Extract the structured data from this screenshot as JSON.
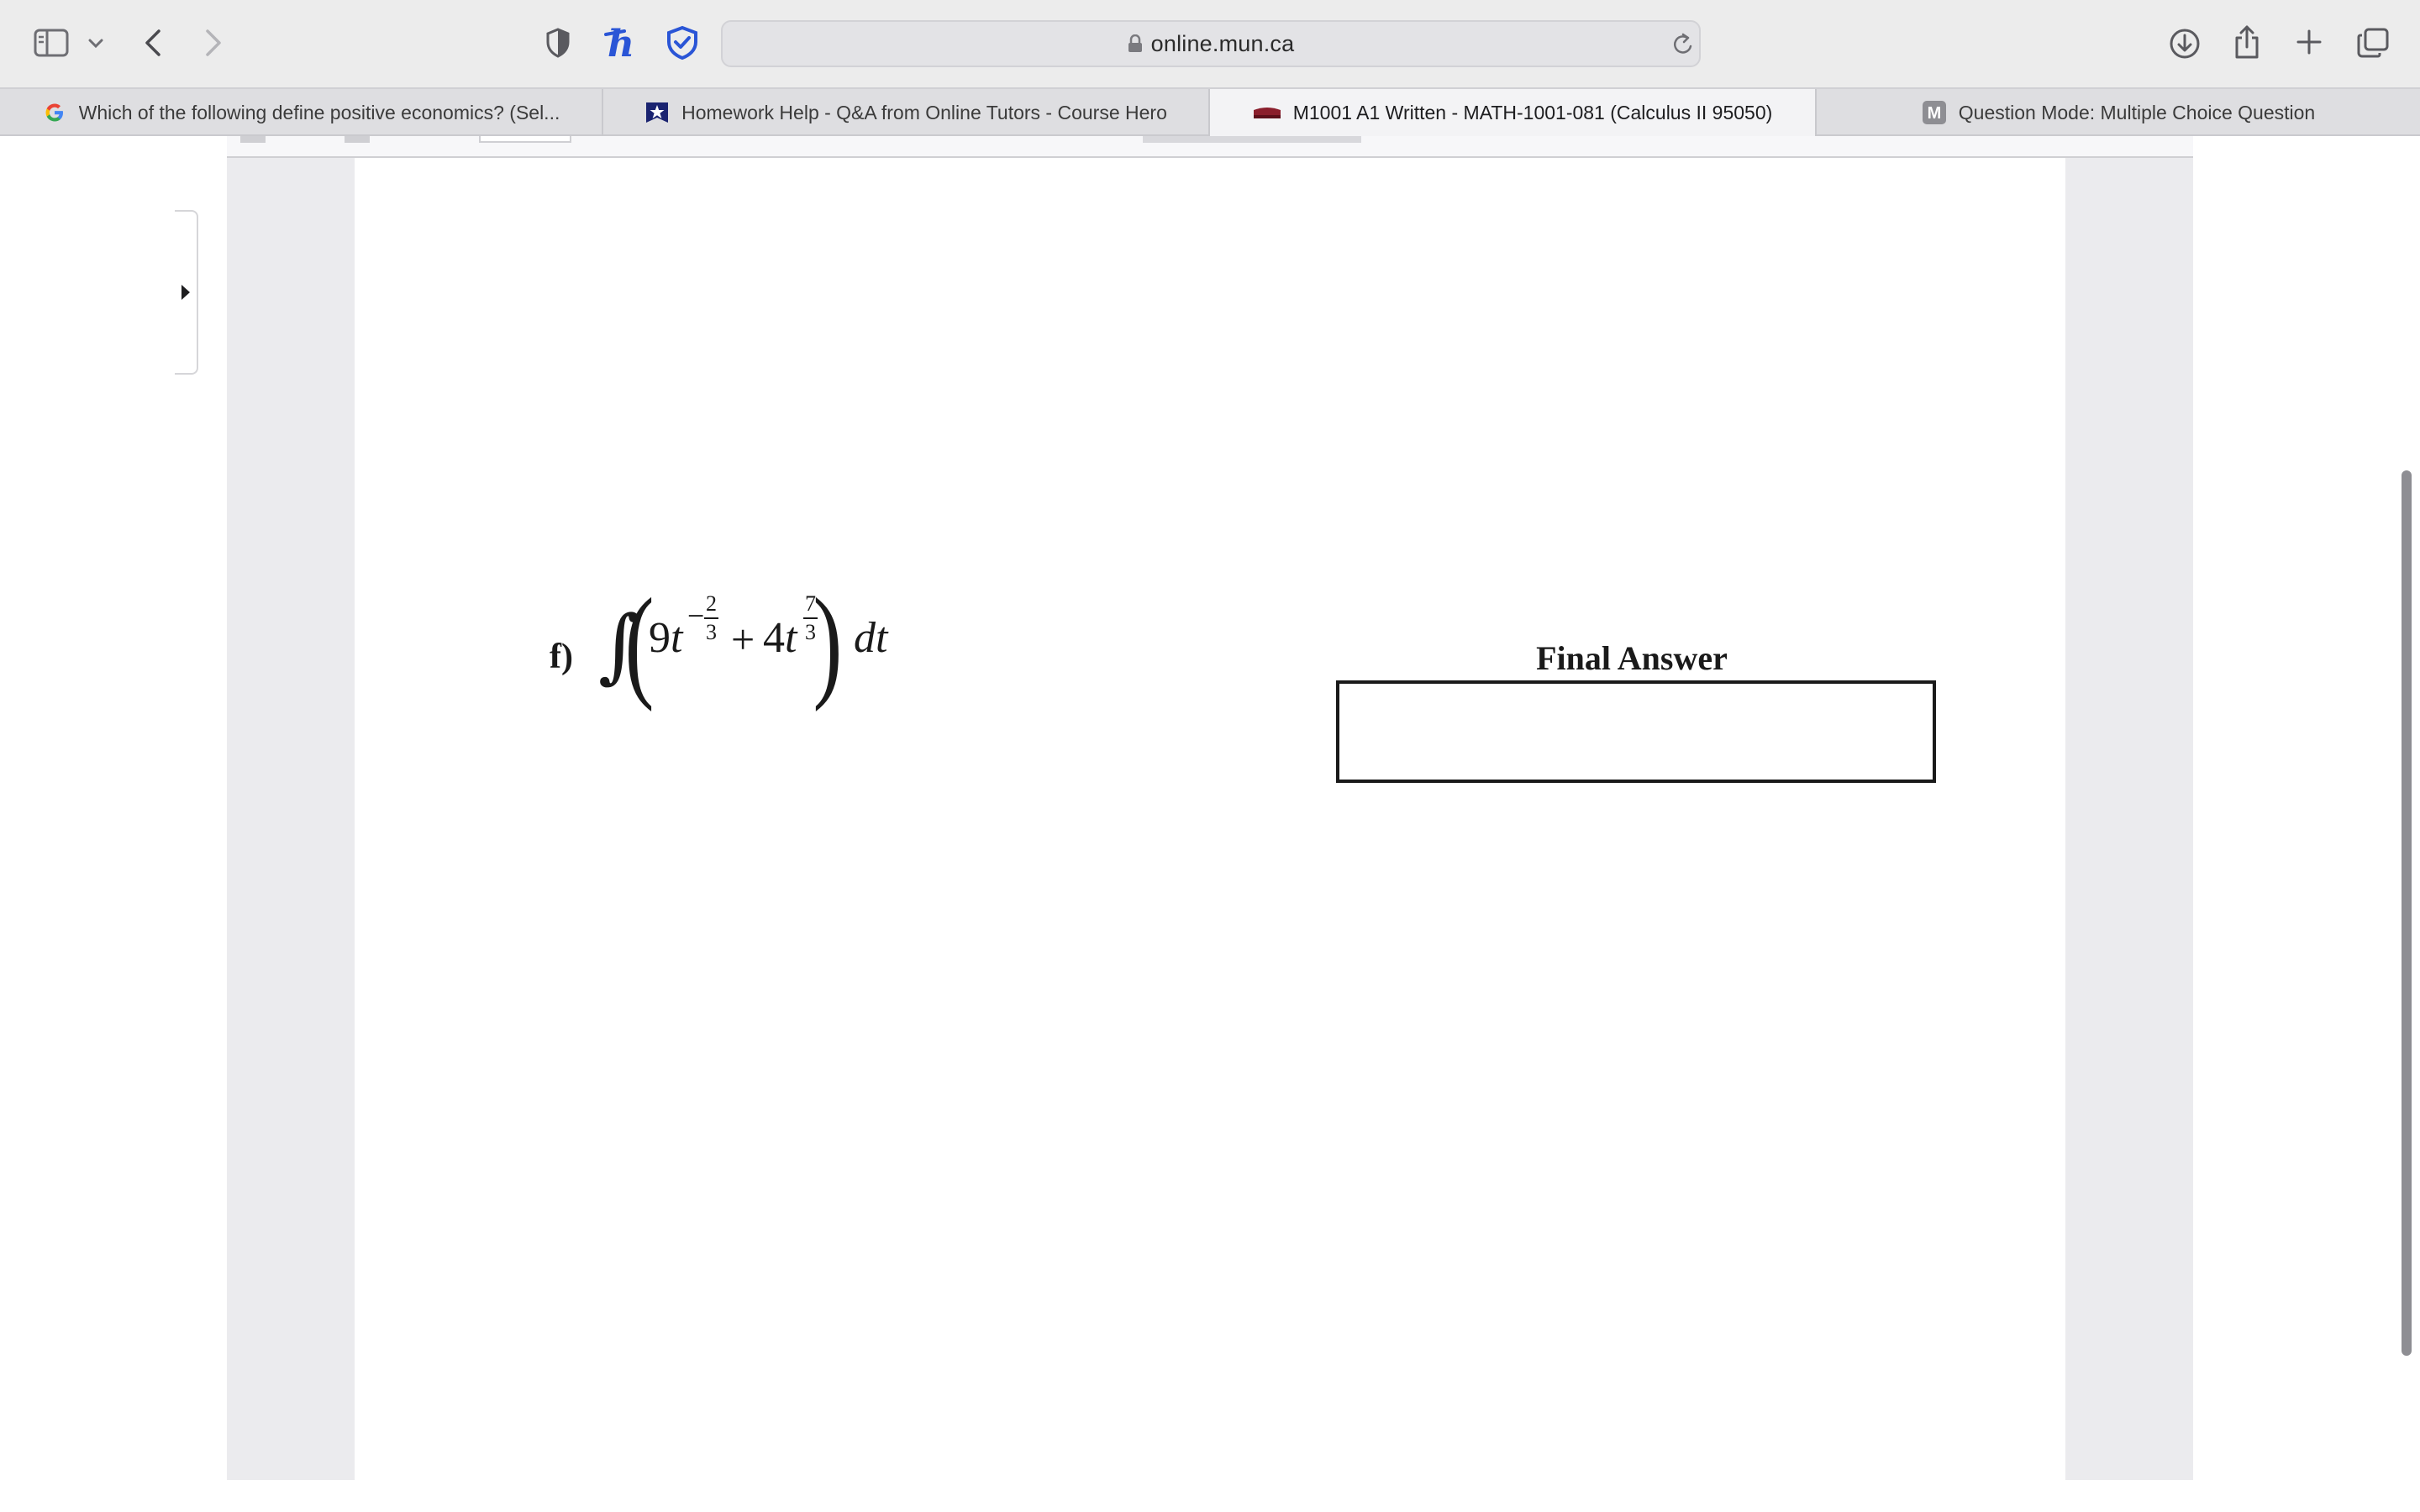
{
  "browser": {
    "url": "online.mun.ca",
    "tabs": [
      {
        "label": "Which of the following define positive economics? (Sel...",
        "icon": "google-icon",
        "active": false
      },
      {
        "label": "Homework Help - Q&A from Online Tutors - Course Hero",
        "icon": "course-hero-icon",
        "active": false
      },
      {
        "label": "M1001 A1 Written - MATH-1001-081 (Calculus II 95050)",
        "icon": "mun-icon",
        "active": true
      },
      {
        "label": "Question Mode: Multiple Choice Question",
        "icon": "m-icon",
        "active": false
      }
    ],
    "icons": {
      "sidebar": "sidebar-icon",
      "chevron": "chevron-down-icon",
      "back": "back-icon",
      "forward": "forward-icon",
      "privacy": "shield-half-icon",
      "extension_h": "h-extension-icon",
      "extension_shield": "shield-check-icon",
      "reload": "reload-icon",
      "download": "download-icon",
      "share": "share-icon",
      "new_tab": "plus-icon",
      "tab_overview": "tabs-overview-icon"
    },
    "colors": {
      "accent_blue": "#2a55d6",
      "course_hero_navy": "#1a2370"
    }
  },
  "document": {
    "problem_label": "f)",
    "integral_sign": "∫",
    "term1_coef": "9",
    "term1_var": "t",
    "term1_exp_sign": "−",
    "term1_exp_num": "2",
    "term1_exp_den": "3",
    "operator": "+",
    "term2_coef": "4",
    "term2_var": "t",
    "term2_exp_num": "7",
    "term2_exp_den": "3",
    "differential": "dt",
    "final_answer_label": "Final Answer",
    "final_answer_value": ""
  }
}
